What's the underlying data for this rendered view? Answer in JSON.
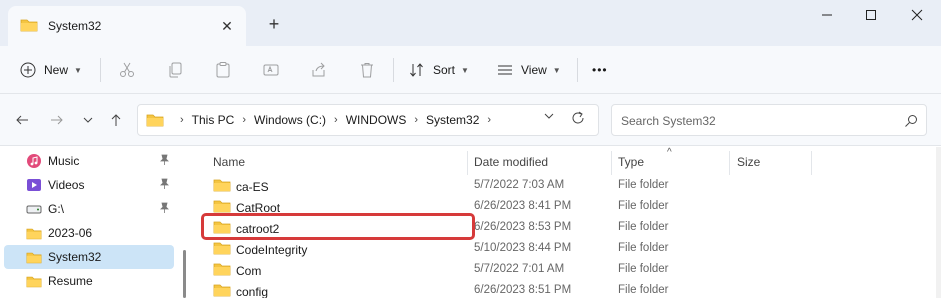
{
  "window": {
    "tab_title": "System32",
    "new_tab_symbol": "+",
    "close_tab_symbol": "✕"
  },
  "toolbar": {
    "new_label": "New",
    "sort_label": "Sort",
    "view_label": "View",
    "more_label": "•••",
    "icons": [
      "cut-icon",
      "copy-icon",
      "paste-icon",
      "rename-icon",
      "share-icon",
      "delete-icon"
    ]
  },
  "address": {
    "crumbs": [
      "This PC",
      "Windows (C:)",
      "WINDOWS",
      "System32"
    ]
  },
  "search": {
    "placeholder": "Search System32"
  },
  "sidebar": {
    "items": [
      {
        "label": "Music",
        "icon": "music-icon",
        "pinned": true
      },
      {
        "label": "Videos",
        "icon": "videos-icon",
        "pinned": true
      },
      {
        "label": "G:\\",
        "icon": "drive-icon",
        "pinned": true
      },
      {
        "label": "2023-06",
        "icon": "folder-icon",
        "pinned": false
      },
      {
        "label": "System32",
        "icon": "folder-icon",
        "pinned": false,
        "selected": true
      },
      {
        "label": "Resume",
        "icon": "folder-icon",
        "pinned": false
      }
    ]
  },
  "files": {
    "columns": [
      "Name",
      "Date modified",
      "Type",
      "Size"
    ],
    "rows": [
      {
        "name": "ca-ES",
        "date": "5/7/2022 7:03 AM",
        "type": "File folder"
      },
      {
        "name": "CatRoot",
        "date": "6/26/2023 8:41 PM",
        "type": "File folder"
      },
      {
        "name": "catroot2",
        "date": "6/26/2023 8:53 PM",
        "type": "File folder",
        "highlighted": true
      },
      {
        "name": "CodeIntegrity",
        "date": "5/10/2023 8:44 PM",
        "type": "File folder"
      },
      {
        "name": "Com",
        "date": "5/7/2022 7:01 AM",
        "type": "File folder"
      },
      {
        "name": "config",
        "date": "6/26/2023 8:51 PM",
        "type": "File folder"
      }
    ]
  },
  "colors": {
    "accent_selected": "#cce4f7",
    "highlight_border": "#d63a3a",
    "folder_yellow": "#f4c542"
  }
}
